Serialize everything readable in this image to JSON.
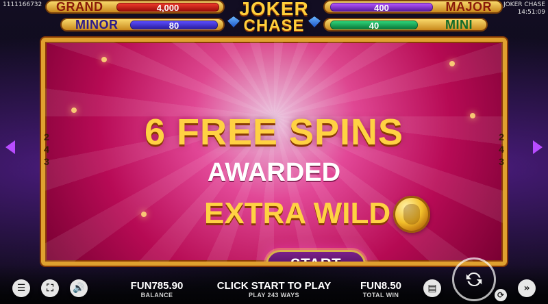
{
  "top_left": {
    "id": "1111166732"
  },
  "top_right": {
    "game": "JOKER CHASE",
    "time": "14:51:09"
  },
  "jackpots": {
    "grand": {
      "label": "GRAND",
      "value": "4,000"
    },
    "major": {
      "label": "MAJOR",
      "value": "400"
    },
    "minor": {
      "label": "MINOR",
      "value": "80"
    },
    "mini": {
      "label": "MINI",
      "value": "40"
    }
  },
  "logo": {
    "line1": "JOKER",
    "line2": "CHASE"
  },
  "dialog": {
    "headline": "6 FREE SPINS",
    "subline": "AWARDED",
    "feature": "EXTRA WILD",
    "start_button": "START"
  },
  "side": {
    "left_numbers": [
      "2",
      "4",
      "3"
    ],
    "right_numbers": [
      "2",
      "4",
      "3"
    ]
  },
  "bottom": {
    "balance_value": "FUN785.90",
    "balance_caption": "BALANCE",
    "center_main": "CLICK START TO PLAY",
    "center_sub": "PLAY 243 WAYS",
    "win_value": "FUN8.50",
    "win_caption": "TOTAL WIN"
  },
  "icons": {
    "menu": "menu-icon",
    "fullscreen": "fullscreen-icon",
    "sound": "sound-icon",
    "info": "info-icon",
    "spin": "spin-icon",
    "autoplay": "autoplay-icon",
    "fast": "fast-forward-icon"
  }
}
